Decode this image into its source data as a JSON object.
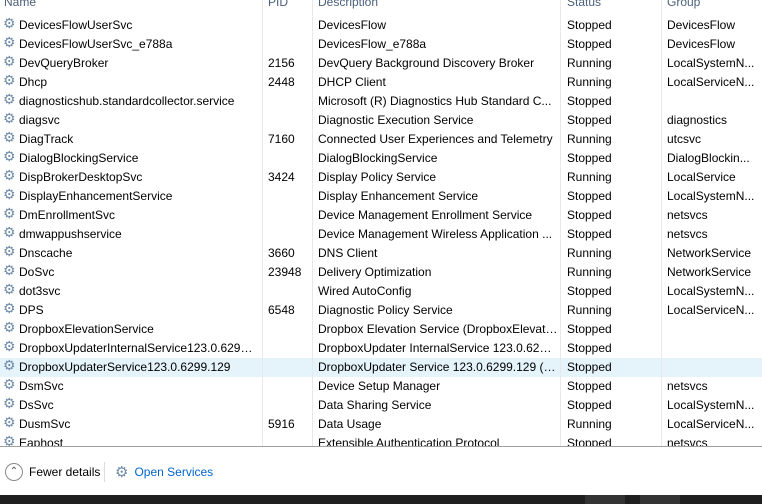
{
  "columns": {
    "name": "Name",
    "pid": "PID",
    "description": "Description",
    "status": "Status",
    "group": "Group"
  },
  "rows": [
    {
      "name": "DevicesFlowUserSvc",
      "pid": "",
      "description": "DevicesFlow",
      "status": "Stopped",
      "group": "DevicesFlow"
    },
    {
      "name": "DevicesFlowUserSvc_e788a",
      "pid": "",
      "description": "DevicesFlow_e788a",
      "status": "Stopped",
      "group": "DevicesFlow"
    },
    {
      "name": "DevQueryBroker",
      "pid": "2156",
      "description": "DevQuery Background Discovery Broker",
      "status": "Running",
      "group": "LocalSystemN..."
    },
    {
      "name": "Dhcp",
      "pid": "2448",
      "description": "DHCP Client",
      "status": "Running",
      "group": "LocalServiceN..."
    },
    {
      "name": "diagnosticshub.standardcollector.service",
      "pid": "",
      "description": "Microsoft (R) Diagnostics Hub Standard C...",
      "status": "Stopped",
      "group": ""
    },
    {
      "name": "diagsvc",
      "pid": "",
      "description": "Diagnostic Execution Service",
      "status": "Stopped",
      "group": "diagnostics"
    },
    {
      "name": "DiagTrack",
      "pid": "7160",
      "description": "Connected User Experiences and Telemetry",
      "status": "Running",
      "group": "utcsvc"
    },
    {
      "name": "DialogBlockingService",
      "pid": "",
      "description": "DialogBlockingService",
      "status": "Stopped",
      "group": "DialogBlockin..."
    },
    {
      "name": "DispBrokerDesktopSvc",
      "pid": "3424",
      "description": "Display Policy Service",
      "status": "Running",
      "group": "LocalService"
    },
    {
      "name": "DisplayEnhancementService",
      "pid": "",
      "description": "Display Enhancement Service",
      "status": "Stopped",
      "group": "LocalSystemN..."
    },
    {
      "name": "DmEnrollmentSvc",
      "pid": "",
      "description": "Device Management Enrollment Service",
      "status": "Stopped",
      "group": "netsvcs"
    },
    {
      "name": "dmwappushservice",
      "pid": "",
      "description": "Device Management Wireless Application ...",
      "status": "Stopped",
      "group": "netsvcs"
    },
    {
      "name": "Dnscache",
      "pid": "3660",
      "description": "DNS Client",
      "status": "Running",
      "group": "NetworkService"
    },
    {
      "name": "DoSvc",
      "pid": "23948",
      "description": "Delivery Optimization",
      "status": "Running",
      "group": "NetworkService"
    },
    {
      "name": "dot3svc",
      "pid": "",
      "description": "Wired AutoConfig",
      "status": "Stopped",
      "group": "LocalSystemN..."
    },
    {
      "name": "DPS",
      "pid": "6548",
      "description": "Diagnostic Policy Service",
      "status": "Running",
      "group": "LocalServiceN..."
    },
    {
      "name": "DropboxElevationService",
      "pid": "",
      "description": "Dropbox Elevation Service (DropboxElevati...",
      "status": "Stopped",
      "group": ""
    },
    {
      "name": "DropboxUpdaterInternalService123.0.6299.1...",
      "pid": "",
      "description": "DropboxUpdater InternalService 123.0.6299....",
      "status": "Stopped",
      "group": ""
    },
    {
      "name": "DropboxUpdaterService123.0.6299.129",
      "pid": "",
      "description": "DropboxUpdater Service 123.0.6299.129 (Dr...",
      "status": "Stopped",
      "group": ""
    },
    {
      "name": "DsmSvc",
      "pid": "",
      "description": "Device Setup Manager",
      "status": "Stopped",
      "group": "netsvcs"
    },
    {
      "name": "DsSvc",
      "pid": "",
      "description": "Data Sharing Service",
      "status": "Stopped",
      "group": "LocalSystemN..."
    },
    {
      "name": "DusmSvc",
      "pid": "5916",
      "description": "Data Usage",
      "status": "Running",
      "group": "LocalServiceN..."
    },
    {
      "name": "Eaphost",
      "pid": "",
      "description": "Extensible Authentication Protocol",
      "status": "Stopped",
      "group": "netsvcs"
    }
  ],
  "selected_index": 18,
  "footer": {
    "fewer_details": "Fewer details",
    "open_services": "Open Services"
  }
}
